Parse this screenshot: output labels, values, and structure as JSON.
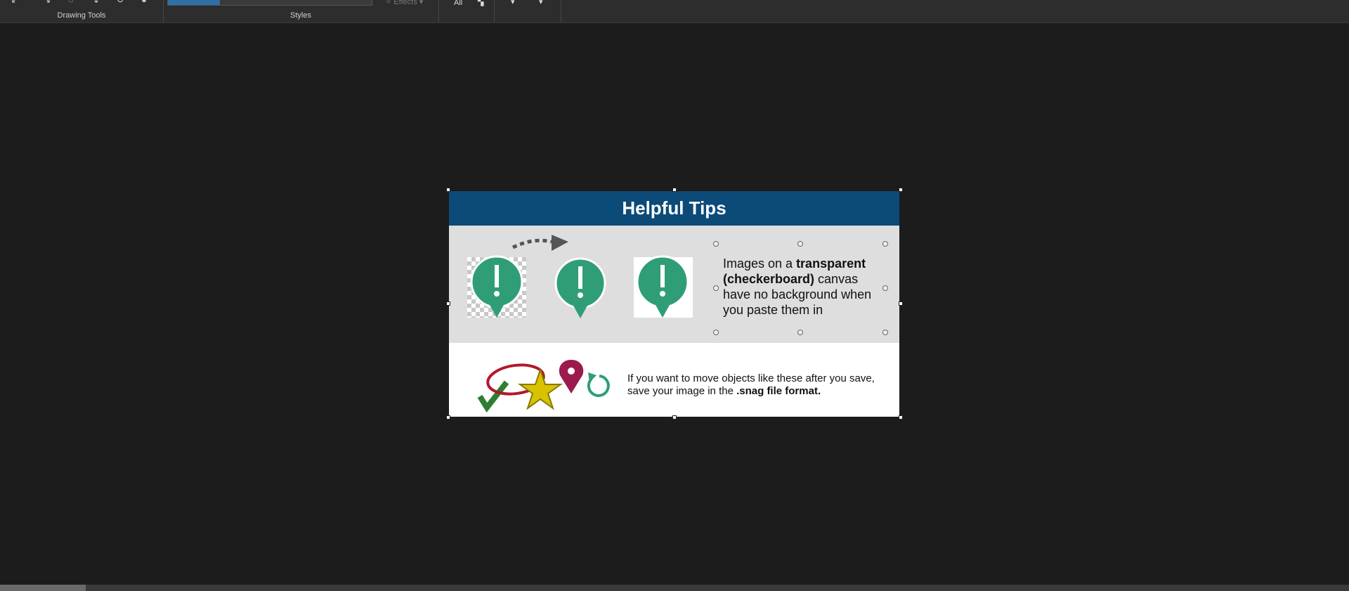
{
  "ribbon": {
    "groups": {
      "drawing_tools": "Drawing Tools",
      "styles": "Styles"
    },
    "effects_label": "Effects",
    "all_label": "All"
  },
  "canvas": {
    "image": {
      "header": "Helpful Tips",
      "tip1": {
        "p1": "Images on a ",
        "b1": "transparent (checkerboard)",
        "p2": " canvas have no background when you paste them in"
      },
      "tip2": {
        "p1": "If you want to move objects like these after you save, save your image in the ",
        "b1": ".snag file format."
      }
    }
  },
  "colors": {
    "accent_green": "#2f9e77",
    "header_blue": "#0c4a78",
    "pin_red": "#9b1b4f"
  },
  "icons": [
    "alert-pin-icon",
    "check-icon",
    "star-icon",
    "location-pin-icon",
    "refresh-icon",
    "arrow-icon"
  ]
}
